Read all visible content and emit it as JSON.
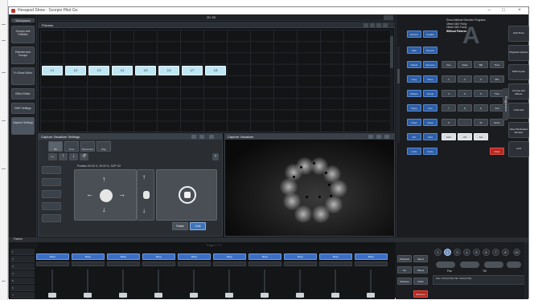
{
  "window": {
    "title": "Hexapod Show - Scorpio Pilot Go"
  },
  "toolbar": {
    "center_label": "2D 3D",
    "tab_left": "Workspaces"
  },
  "sidebar": {
    "items": [
      {
        "label": "Groups and Palettes"
      },
      {
        "label": "Patched and Groups"
      },
      {
        "label": "Fx Show Editor"
      },
      {
        "label": "Effect Editor"
      },
      {
        "label": "DMX Settings"
      },
      {
        "label": "Capture Settings"
      }
    ]
  },
  "fixtures": {
    "title": "Fixtures",
    "cells": [
      "1/1",
      "1/2",
      "1/3",
      "1/4",
      "1/5",
      "1/6",
      "1/7",
      "1/8"
    ]
  },
  "capture_settings": {
    "title": "Capture Visualizer Settings",
    "tabs": [
      "Mb",
      "Tone",
      "Movement",
      "Play"
    ],
    "subtitle": "Position 30.00 S, 30.00 S, SOP S2",
    "mode_buttons": [
      "Rotate",
      "Orbit"
    ]
  },
  "capture_visualizer": {
    "title": "Capture Visualizer"
  },
  "right_panel": {
    "info": [
      "Show   Attribute   Direction   Programs",
      "Offset DMX Parity",
      "Offset DMX Parity",
      "Without Fixtures"
    ],
    "left_buttons": [
      "Record",
      "Update",
      "Edit",
      "Record",
      "Delete",
      "Remove",
      "Copy",
      "Move",
      "Pattern",
      "Group",
      "Clone",
      "Cue",
      "Clear",
      "Snap",
      "Mix",
      "Park",
      "Undo",
      "Redo"
    ],
    "grid_buttons": [
      "Cue",
      "Fade",
      "Blk",
      "Time",
      "1",
      "2",
      "3",
      "Rtn",
      "4",
      "5",
      "6",
      "Thru",
      "7",
      "8",
      "9",
      "Full",
      "0",
      ".",
      "At",
      "Enter",
      "Mod",
      "Off",
      "Set",
      "Clear"
    ],
    "side_tabs": [
      "Edit Show",
      "Playback Options",
      "DMX Inputs",
      "Groups and Effects",
      "Channels",
      "Save Workspace Window",
      "Lock"
    ],
    "programmer_tab": "Programmer"
  },
  "bottom": {
    "strip_label": "Faders",
    "page_title": "Page 1 / 2",
    "rows": [
      "1",
      "2",
      "3",
      "4",
      "5",
      "6",
      "7"
    ],
    "fader_names": [
      "Beep",
      "Beep",
      "Beep",
      "Beep",
      "Beep",
      "Beep",
      "Beep",
      "Beep",
      "Beep",
      "Beep"
    ],
    "fader_sub": [
      "",
      "",
      "",
      "",
      "",
      "",
      "",
      "",
      "",
      ""
    ],
    "right_buttons": [
      "Playback",
      "Select",
      "Go",
      "Pause",
      "Release",
      "Flash",
      "Blackout"
    ],
    "numbers": [
      "1",
      "2",
      "3",
      "4",
      "5",
      "6",
      "7",
      "8",
      "10"
    ],
    "selected_number": "2",
    "pan_label": "Pan",
    "tilt_label": "Tilt",
    "pan_tilt_values": "Pan: 0.00 (0.0%)   Tilt: 0.00 (0.0%)"
  }
}
